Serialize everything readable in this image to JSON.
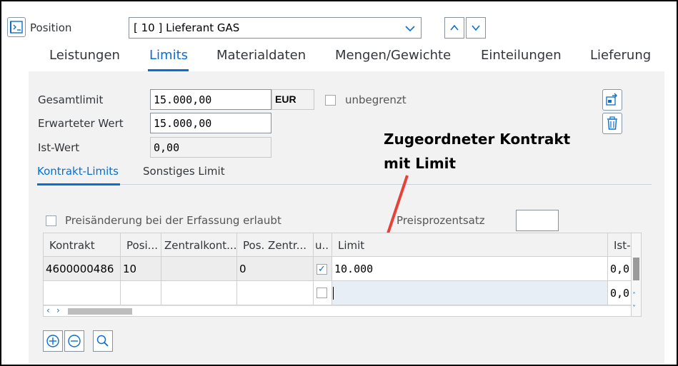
{
  "header": {
    "position_label": "Position",
    "position_value": "[ 10 ] Lieferant GAS"
  },
  "tabs": [
    {
      "label": "Leistungen"
    },
    {
      "label": "Limits"
    },
    {
      "label": "Materialdaten"
    },
    {
      "label": "Mengen/Gewichte"
    },
    {
      "label": "Einteilungen"
    },
    {
      "label": "Lieferung"
    }
  ],
  "limits": {
    "gesamtlimit_label": "Gesamtlimit",
    "gesamtlimit_value": "15.000,00",
    "currency": "EUR",
    "unbegrenzt_label": "unbegrenzt",
    "erwarteter_label": "Erwarteter Wert",
    "erwarteter_value": "15.000,00",
    "istwert_label": "Ist-Wert",
    "istwert_value": "0,00"
  },
  "subtabs": [
    {
      "label": "Kontrakt-Limits"
    },
    {
      "label": "Sonstiges Limit"
    }
  ],
  "contract": {
    "preisaenderung_label": "Preisänderung bei der Erfassung erlaubt",
    "preisprozentsatz_label": "Preisprozentsatz",
    "preisprozentsatz_value": ""
  },
  "table": {
    "headers": [
      "Kontrakt",
      "Posi...",
      "Zentralkont...",
      "Pos. Zentr...",
      "u..",
      "Limit",
      "Ist-"
    ],
    "rows": [
      {
        "kontrakt": "4600000486",
        "pos": "10",
        "zentral": "",
        "poszentr": "0",
        "unbegrenzt": "✓",
        "limit": "10.000",
        "ist": "0,0"
      },
      {
        "kontrakt": "",
        "pos": "",
        "zentral": "",
        "poszentr": "",
        "unbegrenzt": "",
        "limit": "",
        "ist": "0,0"
      }
    ]
  },
  "annotation": {
    "line1": "Zugeordneter Kontrakt",
    "line2": "mit Limit",
    "arrow_color": "#e8413a"
  },
  "colors": {
    "accent": "#0a6ed1",
    "annotation_arrow": "#e8413a"
  },
  "icons": [
    "collapse-icon",
    "chevron-down-icon",
    "chevron-up-icon",
    "export-icon",
    "trash-icon",
    "add-icon",
    "remove-icon",
    "search-icon"
  ]
}
